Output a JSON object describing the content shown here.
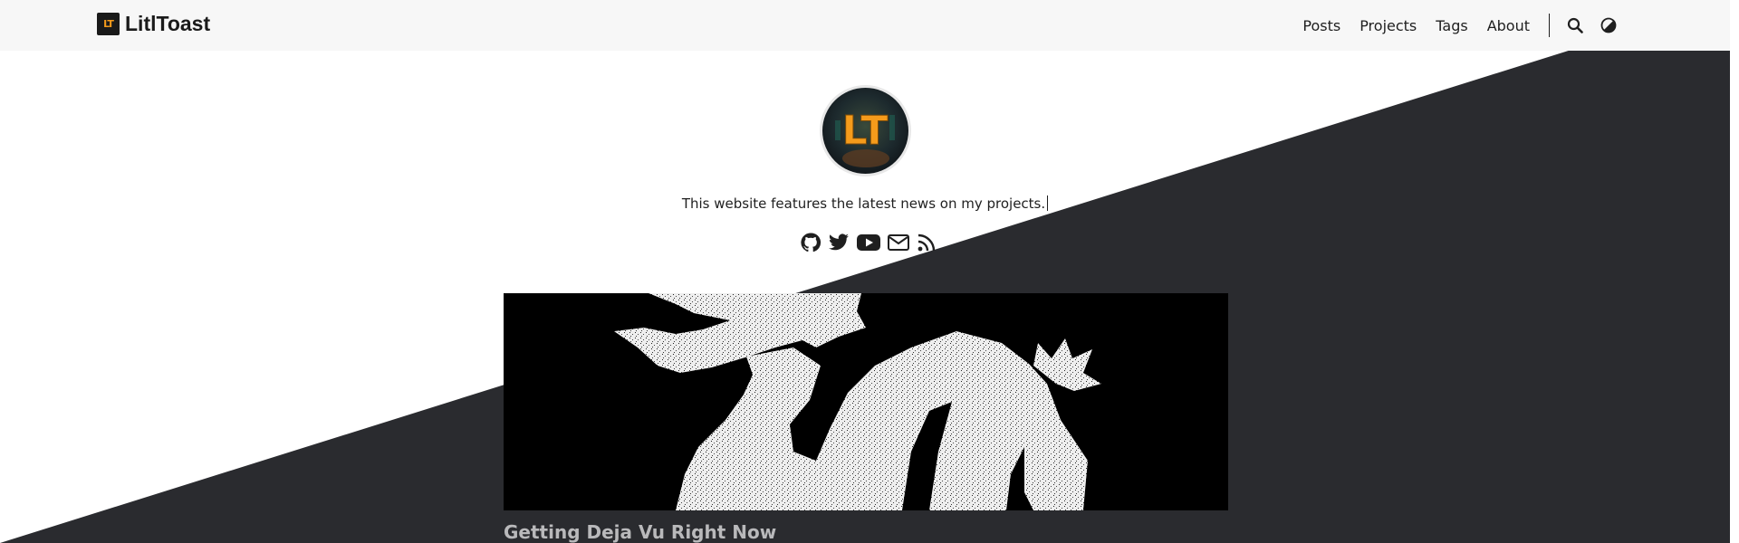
{
  "site": {
    "name": "LitlToast",
    "logo_text": "LT"
  },
  "nav": {
    "items": [
      "Posts",
      "Projects",
      "Tags",
      "About"
    ],
    "search_icon": "search-icon",
    "theme_icon": "theme-toggle-icon"
  },
  "profile": {
    "avatar_text": "LT",
    "bio": "This website features the latest news on my projects.",
    "socials": [
      "github-icon",
      "twitter-icon",
      "youtube-icon",
      "email-icon",
      "rss-icon"
    ]
  },
  "post": {
    "title": "Getting Deja Vu Right Now"
  },
  "colors": {
    "header_bg": "#f7f7f7",
    "dark_bg": "#2a2b2f",
    "accent": "#f59b1b"
  }
}
